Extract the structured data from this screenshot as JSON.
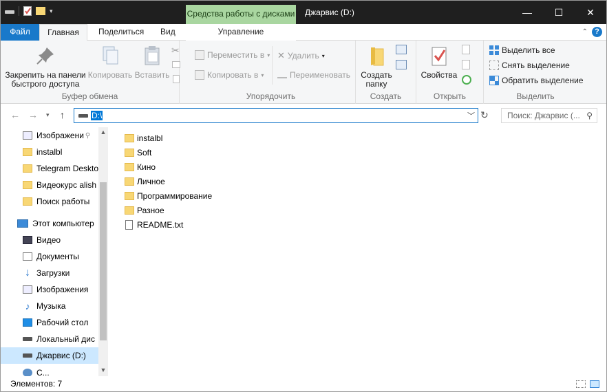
{
  "window": {
    "title": "Джарвис (D:)",
    "context_tab": "Средства работы с дисками",
    "minimize": "—",
    "maximize": "☐",
    "close": "✕"
  },
  "tabs": {
    "file": "Файл",
    "home": "Главная",
    "share": "Поделиться",
    "view": "Вид",
    "manage": "Управление"
  },
  "ribbon": {
    "clipboard": {
      "label": "Буфер обмена",
      "pin": "Закрепить на панели быстрого доступа",
      "copy": "Копировать",
      "paste": "Вставить"
    },
    "organize": {
      "label": "Упорядочить",
      "move": "Переместить в",
      "copy_to": "Копировать в",
      "delete": "Удалить",
      "rename": "Переименовать"
    },
    "create": {
      "label": "Создать",
      "new_folder": "Создать папку"
    },
    "open": {
      "label": "Открыть",
      "properties": "Свойства"
    },
    "select": {
      "label": "Выделить",
      "select_all": "Выделить все",
      "select_none": "Снять выделение",
      "invert": "Обратить выделение"
    }
  },
  "address": {
    "path": "D:\\",
    "search_placeholder": "Поиск: Джарвис (..."
  },
  "sidebar": {
    "items": [
      {
        "label": "Изображени",
        "icon": "pictures-icon"
      },
      {
        "label": "instalbl",
        "icon": "folder-icon"
      },
      {
        "label": "Telegram Deskto",
        "icon": "folder-icon"
      },
      {
        "label": "Видеокурс alish",
        "icon": "folder-icon"
      },
      {
        "label": "Поиск работы",
        "icon": "folder-icon"
      },
      {
        "label": "Этот компьютер",
        "icon": "computer-icon"
      },
      {
        "label": "Видео",
        "icon": "video-icon"
      },
      {
        "label": "Документы",
        "icon": "documents-icon"
      },
      {
        "label": "Загрузки",
        "icon": "downloads-icon"
      },
      {
        "label": "Изображения",
        "icon": "pictures-icon"
      },
      {
        "label": "Музыка",
        "icon": "music-icon"
      },
      {
        "label": "Рабочий стол",
        "icon": "desktop-icon"
      },
      {
        "label": "Локальный дис",
        "icon": "drive-icon"
      },
      {
        "label": "Джарвис (D:)",
        "icon": "drive-icon"
      },
      {
        "label": "С...",
        "icon": "network-icon"
      }
    ]
  },
  "files": [
    {
      "name": "instalbl",
      "type": "folder"
    },
    {
      "name": "Soft",
      "type": "folder"
    },
    {
      "name": "Кино",
      "type": "folder"
    },
    {
      "name": "Личное",
      "type": "folder"
    },
    {
      "name": "Программирование",
      "type": "folder"
    },
    {
      "name": "Разное",
      "type": "folder"
    },
    {
      "name": "README.txt",
      "type": "text-file"
    }
  ],
  "status": {
    "count": "Элементов: 7"
  },
  "colors": {
    "accent": "#1979ca",
    "context_tab": "#a9d6a0",
    "title_bar": "#1f1f1f",
    "folder": "#f8d775",
    "selection": "#cce8ff"
  }
}
